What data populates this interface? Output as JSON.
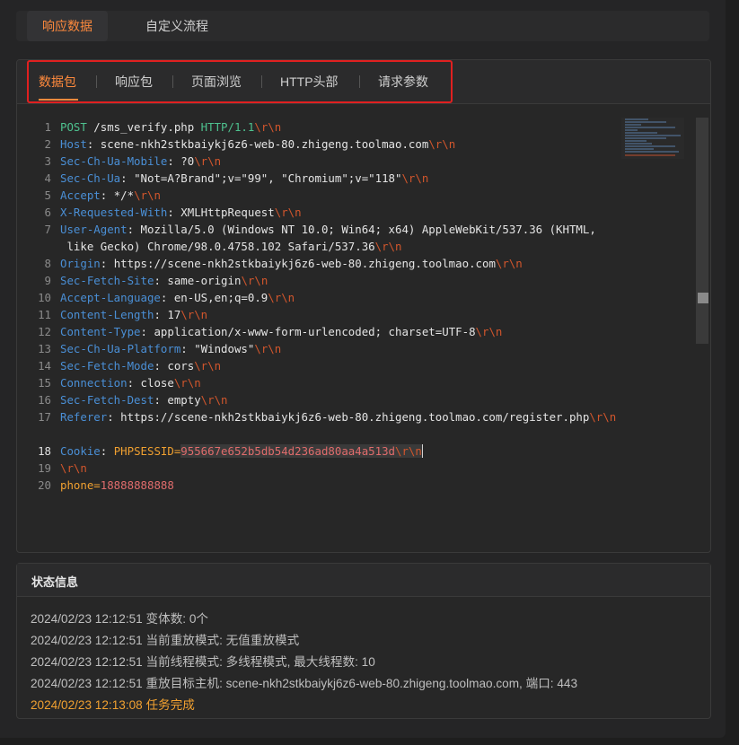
{
  "top_tabs": [
    "响应数据",
    "自定义流程"
  ],
  "sub_tabs": [
    "数据包",
    "响应包",
    "页面浏览",
    "HTTP头部",
    "请求参数"
  ],
  "request": {
    "method": "POST",
    "path": " /sms_verify.php ",
    "version": "HTTP/1.1",
    "crlf": "\\r\\n",
    "headers": [
      {
        "n": "2",
        "k": "Host",
        "v": " scene-nkh2stkbaiykj6z6-web-80.zhigeng.toolmao.com"
      },
      {
        "n": "3",
        "k": "Sec-Ch-Ua-Mobile",
        "v": " ?0"
      },
      {
        "n": "4",
        "k": "Sec-Ch-Ua",
        "v": " \"Not=A?Brand\";v=\"99\", \"Chromium\";v=\"118\""
      },
      {
        "n": "5",
        "k": "Accept",
        "v": " */*"
      },
      {
        "n": "6",
        "k": "X-Requested-With",
        "v": " XMLHttpRequest"
      },
      {
        "n": "7",
        "k": "User-Agent",
        "v": " Mozilla/5.0 (Windows NT 10.0; Win64; x64) AppleWebKit/537.36 (KHTML,"
      },
      {
        "n": "",
        "k": "",
        "v": " like Gecko) Chrome/98.0.4758.102 Safari/537.36"
      },
      {
        "n": "8",
        "k": "Origin",
        "v": " https://scene-nkh2stkbaiykj6z6-web-80.zhigeng.toolmao.com"
      },
      {
        "n": "9",
        "k": "Sec-Fetch-Site",
        "v": " same-origin"
      },
      {
        "n": "10",
        "k": "Accept-Language",
        "v": " en-US,en;q=0.9"
      },
      {
        "n": "11",
        "k": "Content-Length",
        "v": " 17"
      },
      {
        "n": "12",
        "k": "Content-Type",
        "v": " application/x-www-form-urlencoded; charset=UTF-8"
      },
      {
        "n": "13",
        "k": "Sec-Ch-Ua-Platform",
        "v": " \"Windows\""
      },
      {
        "n": "14",
        "k": "Sec-Fetch-Mode",
        "v": " cors"
      },
      {
        "n": "15",
        "k": "Connection",
        "v": " close"
      },
      {
        "n": "16",
        "k": "Sec-Fetch-Dest",
        "v": " empty"
      },
      {
        "n": "17",
        "k": "Referer",
        "v": " https://scene-nkh2stkbaiykj6z6-web-80.zhigeng.toolmao.com/register.php"
      }
    ],
    "cookie_line": "18",
    "cookie_key": "Cookie",
    "cookie_name": " PHPSESSID=",
    "cookie_value": "955667e652b5db54d236ad80aa4a513d",
    "blank_line": "19",
    "body_line": "20",
    "body_key": "phone=",
    "body_value": "18888888888"
  },
  "status": {
    "title": "状态信息",
    "logs": [
      "2024/02/23 12:12:51 变体数: 0个",
      "2024/02/23 12:12:51 当前重放模式: 无值重放模式",
      "2024/02/23 12:12:51 当前线程模式: 多线程模式, 最大线程数: 10",
      "2024/02/23 12:12:51 重放目标主机: scene-nkh2stkbaiykj6z6-web-80.zhigeng.toolmao.com, 端口: 443",
      "2024/02/23 12:13:08 任务完成"
    ]
  },
  "colors": {
    "accent": "#ff8a3d",
    "highlight_box": "#e02020",
    "header_key": "#4a8fd6",
    "crlf": "#d2562c"
  }
}
